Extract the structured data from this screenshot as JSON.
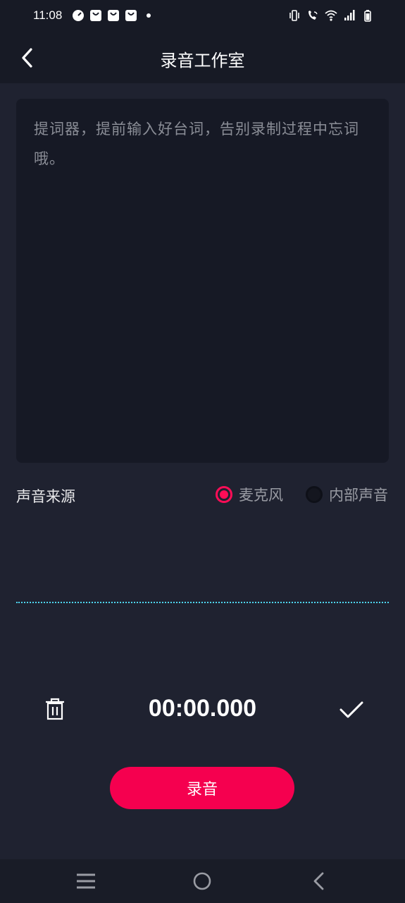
{
  "status_bar": {
    "time": "11:08",
    "left_icons": [
      "speedometer-icon",
      "shopping-bag-icon",
      "shopping-bag-icon",
      "shopping-bag-icon",
      "dot-icon"
    ],
    "right_icons": [
      "vibrate-icon",
      "wifi-call-icon",
      "wifi-icon",
      "signal-icon",
      "battery-icon"
    ]
  },
  "header": {
    "title": "录音工作室",
    "back_icon": "chevron-left-icon"
  },
  "teleprompter": {
    "placeholder": "提词器，提前输入好台词，告别录制过程中忘词哦。",
    "value": ""
  },
  "audio_source": {
    "label": "声音来源",
    "options": [
      {
        "label": "麦克风",
        "selected": true
      },
      {
        "label": "内部声音",
        "selected": false
      }
    ]
  },
  "waveform": {
    "color": "#4fd6f0"
  },
  "controls": {
    "timer": "00:00.000",
    "delete_icon": "trash-icon",
    "confirm_icon": "checkmark-icon"
  },
  "record_button": {
    "label": "录音",
    "color": "#f5004f"
  },
  "nav_bar": {
    "icons": [
      "menu-icon",
      "home-circle-icon",
      "back-chevron-icon"
    ]
  }
}
